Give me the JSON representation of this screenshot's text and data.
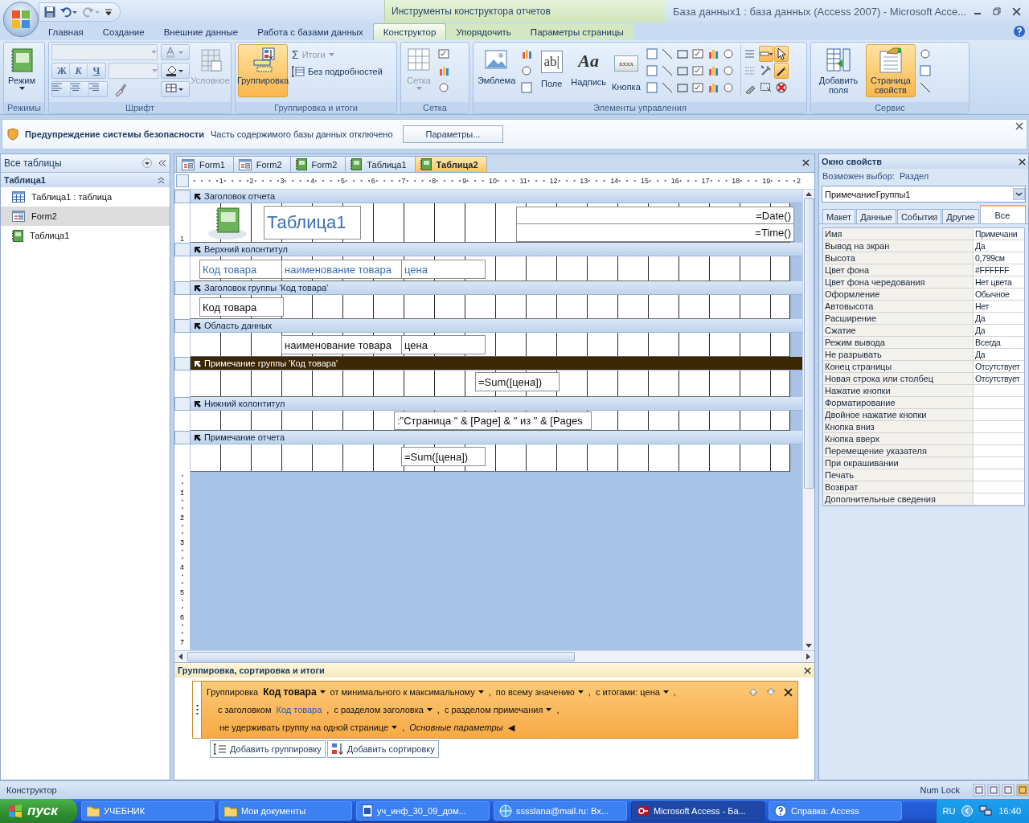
{
  "window": {
    "title": "База данных1 : база данных (Access 2007) - Microsoft Acce...",
    "context_label": "Инструменты конструктора отчетов"
  },
  "ribbon_tabs": [
    {
      "label": "Главная",
      "selected": false
    },
    {
      "label": "Создание",
      "selected": false
    },
    {
      "label": "Внешние данные",
      "selected": false
    },
    {
      "label": "Работа с базами данных",
      "selected": false
    },
    {
      "label": "Конструктор",
      "selected": true
    },
    {
      "label": "Упорядочить",
      "selected": false
    },
    {
      "label": "Параметры страницы",
      "selected": false
    }
  ],
  "ribbon_groups": [
    {
      "label": "Режимы",
      "items": [
        {
          "kind": "large",
          "label": "Режим",
          "dropdown": true,
          "selected": false,
          "disabled": false
        }
      ]
    },
    {
      "label": "Шрифт",
      "items": [
        {
          "kind": "font_block",
          "format_keys": [
            "Ж",
            "К",
            "Ч"
          ]
        },
        {
          "kind": "large",
          "label": "Условное",
          "dropdown": false,
          "selected": false,
          "disabled": true
        }
      ]
    },
    {
      "label": "Группировка и итоги",
      "items": [
        {
          "kind": "large",
          "label": "Группировка",
          "dropdown": false,
          "selected": true,
          "disabled": false
        },
        {
          "kind": "small_column",
          "buttons": [
            {
              "label": "Итоги",
              "symbol": "Σ",
              "dropdown": true,
              "disabled": true
            },
            {
              "label": "Без подробностей",
              "dropdown": false,
              "disabled": false
            }
          ]
        }
      ]
    },
    {
      "label": "Сетка",
      "items": [
        {
          "kind": "large",
          "label": "Сетка",
          "dropdown": true,
          "selected": false,
          "disabled": true
        },
        {
          "kind": "icon_column"
        }
      ]
    },
    {
      "label": "Элементы управления",
      "items": [
        {
          "kind": "large",
          "label": "Эмблема",
          "dropdown": false,
          "selected": false,
          "disabled": false
        },
        {
          "kind": "icon_column"
        },
        {
          "kind": "glyph",
          "label": "Поле",
          "glyph": "ab|"
        },
        {
          "kind": "glyph",
          "label": "Надпись",
          "glyph": "Aa"
        },
        {
          "kind": "glyph",
          "label": "Кнопка",
          "glyph": "xxxx"
        },
        {
          "kind": "icon_grid"
        },
        {
          "kind": "tool_grid",
          "tools": [
            {
              "selected": false
            },
            {
              "selected": true
            },
            {
              "selected": true
            },
            {
              "selected": false
            },
            {
              "selected": false
            },
            {
              "selected": true
            },
            {
              "selected": false
            },
            {
              "selected": false
            },
            {
              "selected": false
            }
          ]
        }
      ]
    },
    {
      "label": "Сервис",
      "items": [
        {
          "kind": "large",
          "label": "Добавить поля",
          "dropdown": false,
          "selected": false,
          "disabled": false
        },
        {
          "kind": "large",
          "label": "Страница свойств",
          "dropdown": false,
          "selected": true,
          "disabled": false
        },
        {
          "kind": "icon_column"
        }
      ]
    }
  ],
  "security": {
    "title": "Предупреждение системы безопасности",
    "message": "Часть содержимого базы данных отключено",
    "button": "Параметры..."
  },
  "nav": {
    "header": "Все таблицы",
    "group": {
      "label": "Таблица1",
      "expanded": true
    },
    "items": [
      {
        "label": "Таблица1 : таблица",
        "kind": "table",
        "selected": false
      },
      {
        "label": "Form2",
        "kind": "form",
        "selected": true
      },
      {
        "label": "Таблица1",
        "kind": "report",
        "selected": false
      }
    ]
  },
  "doc_tabs": [
    {
      "label": "Form1",
      "kind": "form",
      "selected": false
    },
    {
      "label": "Form2",
      "kind": "form",
      "selected": false
    },
    {
      "label": "Form2",
      "kind": "report",
      "selected": false
    },
    {
      "label": "Таблица1",
      "kind": "report",
      "selected": false
    },
    {
      "label": "Таблица2",
      "kind": "report",
      "selected": true
    }
  ],
  "ruler": {
    "horizontal": [
      "1",
      "2",
      "3",
      "4",
      "5",
      "6",
      "7",
      "8",
      "9",
      "10",
      "11",
      "12",
      "13",
      "14",
      "15",
      "16",
      "17",
      "18",
      "19",
      "2"
    ],
    "vertical": [
      "1",
      "2",
      "3",
      "4",
      "5",
      "6",
      "7"
    ]
  },
  "report": {
    "sections": [
      {
        "title": "Заголовок отчета",
        "selected": false,
        "ruler_mark": "1",
        "controls": [
          {
            "kind": "logo"
          },
          {
            "kind": "label",
            "text": "Таблица1"
          },
          {
            "kind": "textbox",
            "text": "=Date()"
          },
          {
            "kind": "textbox",
            "text": "=Time()"
          }
        ]
      },
      {
        "title": "Верхний колонтитул",
        "selected": false,
        "controls": [
          {
            "kind": "label",
            "text": "Код товара"
          },
          {
            "kind": "label",
            "text": "наименование товара"
          },
          {
            "kind": "label",
            "text": "цена"
          }
        ]
      },
      {
        "title": "Заголовок группы 'Код товара'",
        "selected": false,
        "controls": [
          {
            "kind": "textbox",
            "text": "Код товара"
          }
        ]
      },
      {
        "title": "Область данных",
        "selected": false,
        "controls": [
          {
            "kind": "textbox",
            "text": "наименование товара"
          },
          {
            "kind": "textbox",
            "text": "цена"
          }
        ]
      },
      {
        "title": "Примечание группы 'Код товара'",
        "selected": true,
        "controls": [
          {
            "kind": "textbox",
            "text": "=Sum([цена])"
          }
        ]
      },
      {
        "title": "Нижний колонтитул",
        "selected": false,
        "controls": [
          {
            "kind": "textbox",
            "text": ":\"Страница \" & [Page] & \" из \" & [Pages"
          }
        ]
      },
      {
        "title": "Примечание отчета",
        "selected": false,
        "controls": [
          {
            "kind": "textbox",
            "text": "=Sum([цена])"
          }
        ]
      }
    ]
  },
  "properties": {
    "title": "Окно свойств",
    "selection_label": "Возможен выбор:",
    "selection_type": "Раздел",
    "object": "ПримечаниеГруппы1",
    "tabs": [
      {
        "label": "Макет",
        "selected": false
      },
      {
        "label": "Данные",
        "selected": false
      },
      {
        "label": "События",
        "selected": false
      },
      {
        "label": "Другие",
        "selected": false
      },
      {
        "label": "Все",
        "selected": true
      }
    ],
    "rows": [
      {
        "name": "Имя",
        "value": "Примечани"
      },
      {
        "name": "Вывод на экран",
        "value": "Да"
      },
      {
        "name": "Высота",
        "value": "0,799см"
      },
      {
        "name": "Цвет фона",
        "value": "#FFFFFF"
      },
      {
        "name": "Цвет фона чередования",
        "value": "Нет цвета"
      },
      {
        "name": "Оформление",
        "value": "Обычное"
      },
      {
        "name": "Автовысота",
        "value": "Нет"
      },
      {
        "name": "Расширение",
        "value": "Да"
      },
      {
        "name": "Сжатие",
        "value": "Да"
      },
      {
        "name": "Режим вывода",
        "value": "Всегда"
      },
      {
        "name": "Не разрывать",
        "value": "Да"
      },
      {
        "name": "Конец страницы",
        "value": "Отсутствует"
      },
      {
        "name": "Новая строка или столбец",
        "value": "Отсутствует"
      },
      {
        "name": "Нажатие кнопки"
      },
      {
        "name": "Форматирование"
      },
      {
        "name": "Двойное нажатие кнопки"
      },
      {
        "name": "Кнопка вниз"
      },
      {
        "name": "Кнопка вверх"
      },
      {
        "name": "Перемещение указателя"
      },
      {
        "name": "При окрашивании"
      },
      {
        "name": "Печать"
      },
      {
        "name": "Возврат"
      },
      {
        "name": "Дополнительные сведения"
      }
    ]
  },
  "grouping": {
    "title": "Группировка, сортировка и итоги",
    "lines": [
      [
        {
          "text": "Группировка",
          "kind": "plain",
          "dropdown": false
        },
        {
          "text": "Код товара",
          "kind": "field",
          "dropdown": true
        },
        {
          "text": "от минимального к максимальному",
          "kind": "plain",
          "dropdown": true
        },
        {
          "text": ",",
          "kind": "plain",
          "dropdown": false
        },
        {
          "text": "по всему значению",
          "kind": "plain",
          "dropdown": true
        },
        {
          "text": ",",
          "kind": "plain",
          "dropdown": false
        },
        {
          "text": "с итогами: цена",
          "kind": "plain",
          "dropdown": true
        },
        {
          "text": ",",
          "kind": "plain",
          "dropdown": false
        }
      ],
      [
        {
          "text": "с заголовком",
          "kind": "plain",
          "dropdown": false
        },
        {
          "text": "Код товара",
          "kind": "link",
          "dropdown": false
        },
        {
          "text": ",",
          "kind": "plain",
          "dropdown": false
        },
        {
          "text": "с разделом заголовка",
          "kind": "plain",
          "dropdown": true
        },
        {
          "text": ",",
          "kind": "plain",
          "dropdown": false
        },
        {
          "text": "с разделом примечания",
          "kind": "plain",
          "dropdown": true
        },
        {
          "text": ",",
          "kind": "plain",
          "dropdown": false
        }
      ],
      [
        {
          "text": "не удерживать группу на одной странице",
          "kind": "plain",
          "dropdown": true
        },
        {
          "text": ",",
          "kind": "plain",
          "dropdown": false
        },
        {
          "text": "Основные параметры",
          "kind": "toggle",
          "dropdown": false
        },
        {
          "text": "◀",
          "kind": "plain",
          "dropdown": false
        }
      ]
    ],
    "buttons": [
      {
        "label": "Добавить группировку",
        "kind": "group"
      },
      {
        "label": "Добавить сортировку",
        "kind": "sort"
      }
    ]
  },
  "status": {
    "mode": "Конструктор",
    "indicator": "Num Lock"
  },
  "taskbar": {
    "start": "пуск",
    "items": [
      {
        "label": "УЧЕБНИК",
        "kind": "folder",
        "selected": false
      },
      {
        "label": "Мои документы",
        "kind": "folder",
        "selected": false
      },
      {
        "label": "уч_инф_30_09_дом...",
        "kind": "document",
        "selected": false
      },
      {
        "label": "sssslana@mail.ru: Вх...",
        "kind": "browser",
        "selected": false
      },
      {
        "label": "Microsoft Access - Ба...",
        "kind": "access",
        "selected": true
      },
      {
        "label": "Справка: Access",
        "kind": "help",
        "selected": false
      }
    ],
    "language": "RU",
    "clock": "16:40"
  }
}
